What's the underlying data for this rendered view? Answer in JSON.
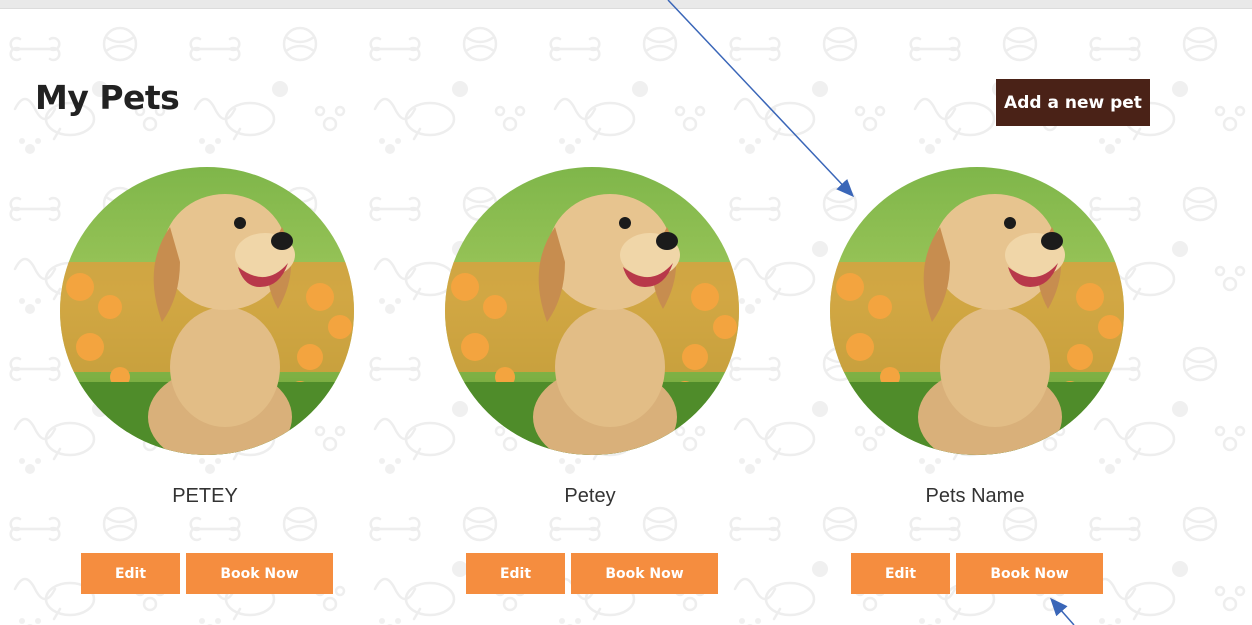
{
  "header": {
    "title": "My Pets",
    "add_button_label": "Add a new pet"
  },
  "pets": [
    {
      "name": "PETEY",
      "edit_label": "Edit",
      "book_label": "Book Now"
    },
    {
      "name": "Petey",
      "edit_label": "Edit",
      "book_label": "Book Now"
    },
    {
      "name": "Pets Name",
      "edit_label": "Edit",
      "book_label": "Book Now"
    }
  ],
  "colors": {
    "brand_dark": "#4a2217",
    "accent_orange": "#f58d3f",
    "annotation_arrow": "#3a66b8"
  },
  "icons": [
    "paw-icon",
    "bone-icon",
    "yarn-ball-icon",
    "dog-doodle-icon"
  ]
}
